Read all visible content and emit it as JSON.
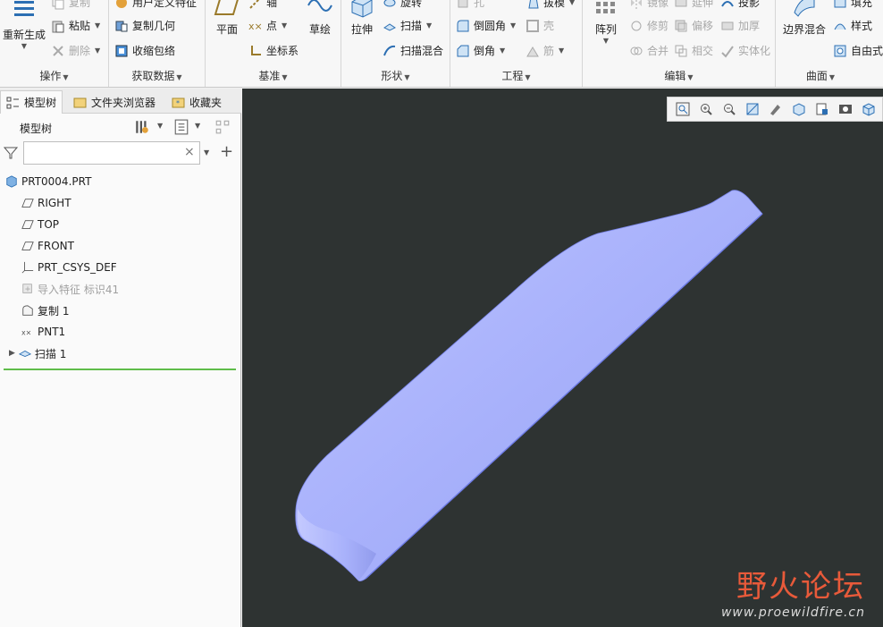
{
  "ribbon": {
    "groups": {
      "operations": {
        "label": "操作",
        "regenerate": "重新生成",
        "copy": "复制",
        "paste": "粘贴",
        "delete": "删除"
      },
      "get_data": {
        "label": "获取数据",
        "udf": "用户定义特征",
        "copy_geometry": "复制几何",
        "shrinkwrap": "收缩包络"
      },
      "datum": {
        "label": "基准",
        "plane": "平面",
        "axis": "轴",
        "point": "点",
        "csys": "坐标系",
        "sketch": "草绘"
      },
      "shapes": {
        "label": "形状",
        "extrude": "拉伸",
        "revolve": "旋转",
        "sweep": "扫描",
        "swept_blend": "扫描混合"
      },
      "engineering": {
        "label": "工程",
        "hole": "孔",
        "round": "倒圆角",
        "chamfer": "倒角",
        "draft": "拔模",
        "shell": "壳",
        "rib": "筋"
      },
      "editing": {
        "label": "编辑",
        "pattern": "阵列",
        "mirror": "镜像",
        "extend": "延伸",
        "project": "投影",
        "trim": "修剪",
        "offset": "偏移",
        "thicken": "加厚",
        "merge": "合并",
        "intersect": "相交",
        "solidify": "实体化"
      },
      "surfaces": {
        "label": "曲面",
        "boundary_blend": "边界混合",
        "fill": "填充",
        "style": "样式",
        "freestyle": "自由式"
      }
    }
  },
  "left_panel": {
    "tabs": [
      "模型树",
      "文件夹浏览器",
      "收藏夹"
    ],
    "tree_title": "模型树",
    "search": {
      "value": "",
      "placeholder": ""
    },
    "tree": [
      {
        "label": "PRT0004.PRT",
        "icon": "part-icon",
        "disabled": false
      },
      {
        "label": "RIGHT",
        "icon": "datum-plane-icon",
        "disabled": false
      },
      {
        "label": "TOP",
        "icon": "datum-plane-icon",
        "disabled": false
      },
      {
        "label": "FRONT",
        "icon": "datum-plane-icon",
        "disabled": false
      },
      {
        "label": "PRT_CSYS_DEF",
        "icon": "csys-icon",
        "disabled": false
      },
      {
        "label": "导入特征 标识41",
        "icon": "import-feature-icon",
        "disabled": true
      },
      {
        "label": "复制 1",
        "icon": "copy-surface-icon",
        "disabled": false
      },
      {
        "label": "PNT1",
        "icon": "datum-point-icon",
        "disabled": false
      },
      {
        "label": "扫描 1",
        "icon": "sweep-icon",
        "disabled": false
      }
    ]
  },
  "viewport": {
    "background": "#2e3332",
    "model_color": "#a8b1fb",
    "toolbar_icons": [
      "refit-icon",
      "zoom-in-icon",
      "zoom-out-icon",
      "repaint-icon",
      "display-style-icon",
      "datum-display-icon",
      "saved-views-icon",
      "view-manager-icon",
      "spin-center-icon"
    ],
    "watermark": {
      "title": "野火论坛",
      "url": "www.proewildfire.cn"
    }
  }
}
